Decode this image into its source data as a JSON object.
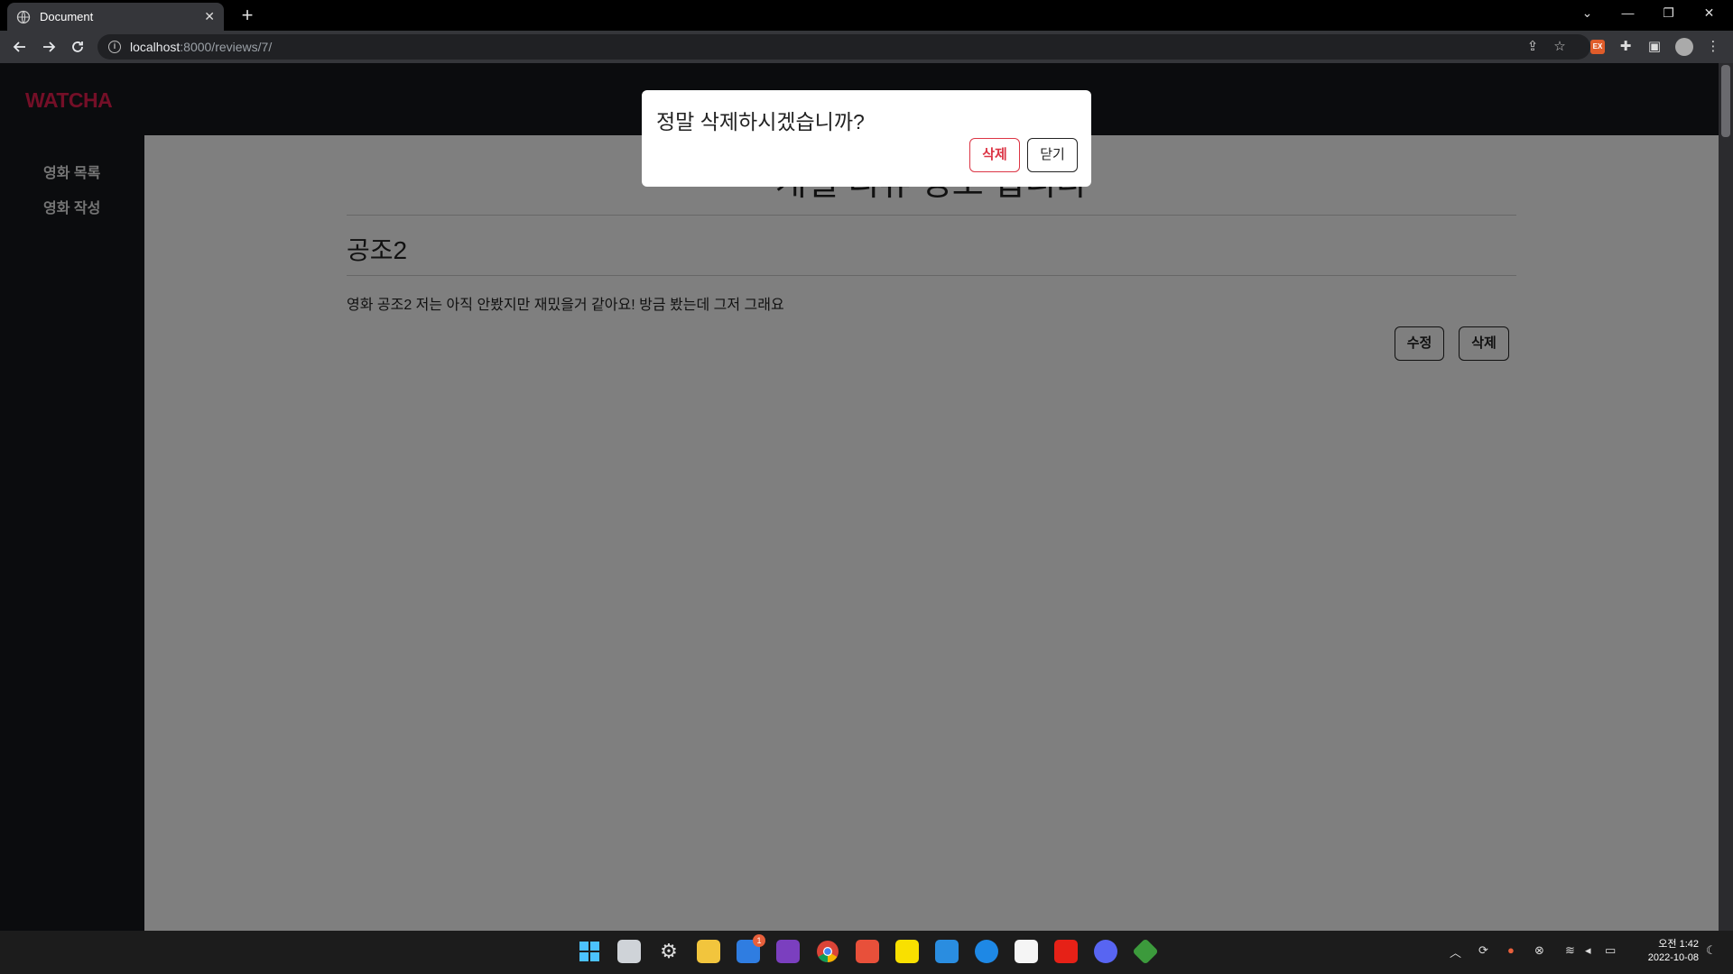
{
  "browser": {
    "tab_title": "Document",
    "tab_close": "✕",
    "new_tab": "+",
    "url_host": "localhost",
    "url_path": ":8000/reviews/7/",
    "win_chevron": "⌄",
    "win_minimize": "—",
    "win_restore": "❐",
    "win_close": "✕",
    "ext_badge": "EX"
  },
  "sidebar": {
    "logo": "WATCHA",
    "items": [
      {
        "label": "영화 목록"
      },
      {
        "label": "영화 작성"
      }
    ]
  },
  "content": {
    "heading": "개별 리뷰 정보 입니다",
    "movie_title": "공조2",
    "review_text": "영화 공조2 저는 아직 안봤지만 재밌을거 같아요! 방금 봤는데 그저 그래요",
    "edit_button": "수정",
    "delete_button": "삭제"
  },
  "modal": {
    "message": "정말 삭제하시겠습니까?",
    "confirm_label": "삭제",
    "close_label": "닫기"
  },
  "taskbar": {
    "notification_badge": "1",
    "clock_ampm_time": "오전 1:42",
    "clock_date": "2022-10-08"
  },
  "colors": {
    "brand": "#e91e4f",
    "danger": "#dc3545",
    "overlay": "rgba(0,0,0,0.5)"
  }
}
